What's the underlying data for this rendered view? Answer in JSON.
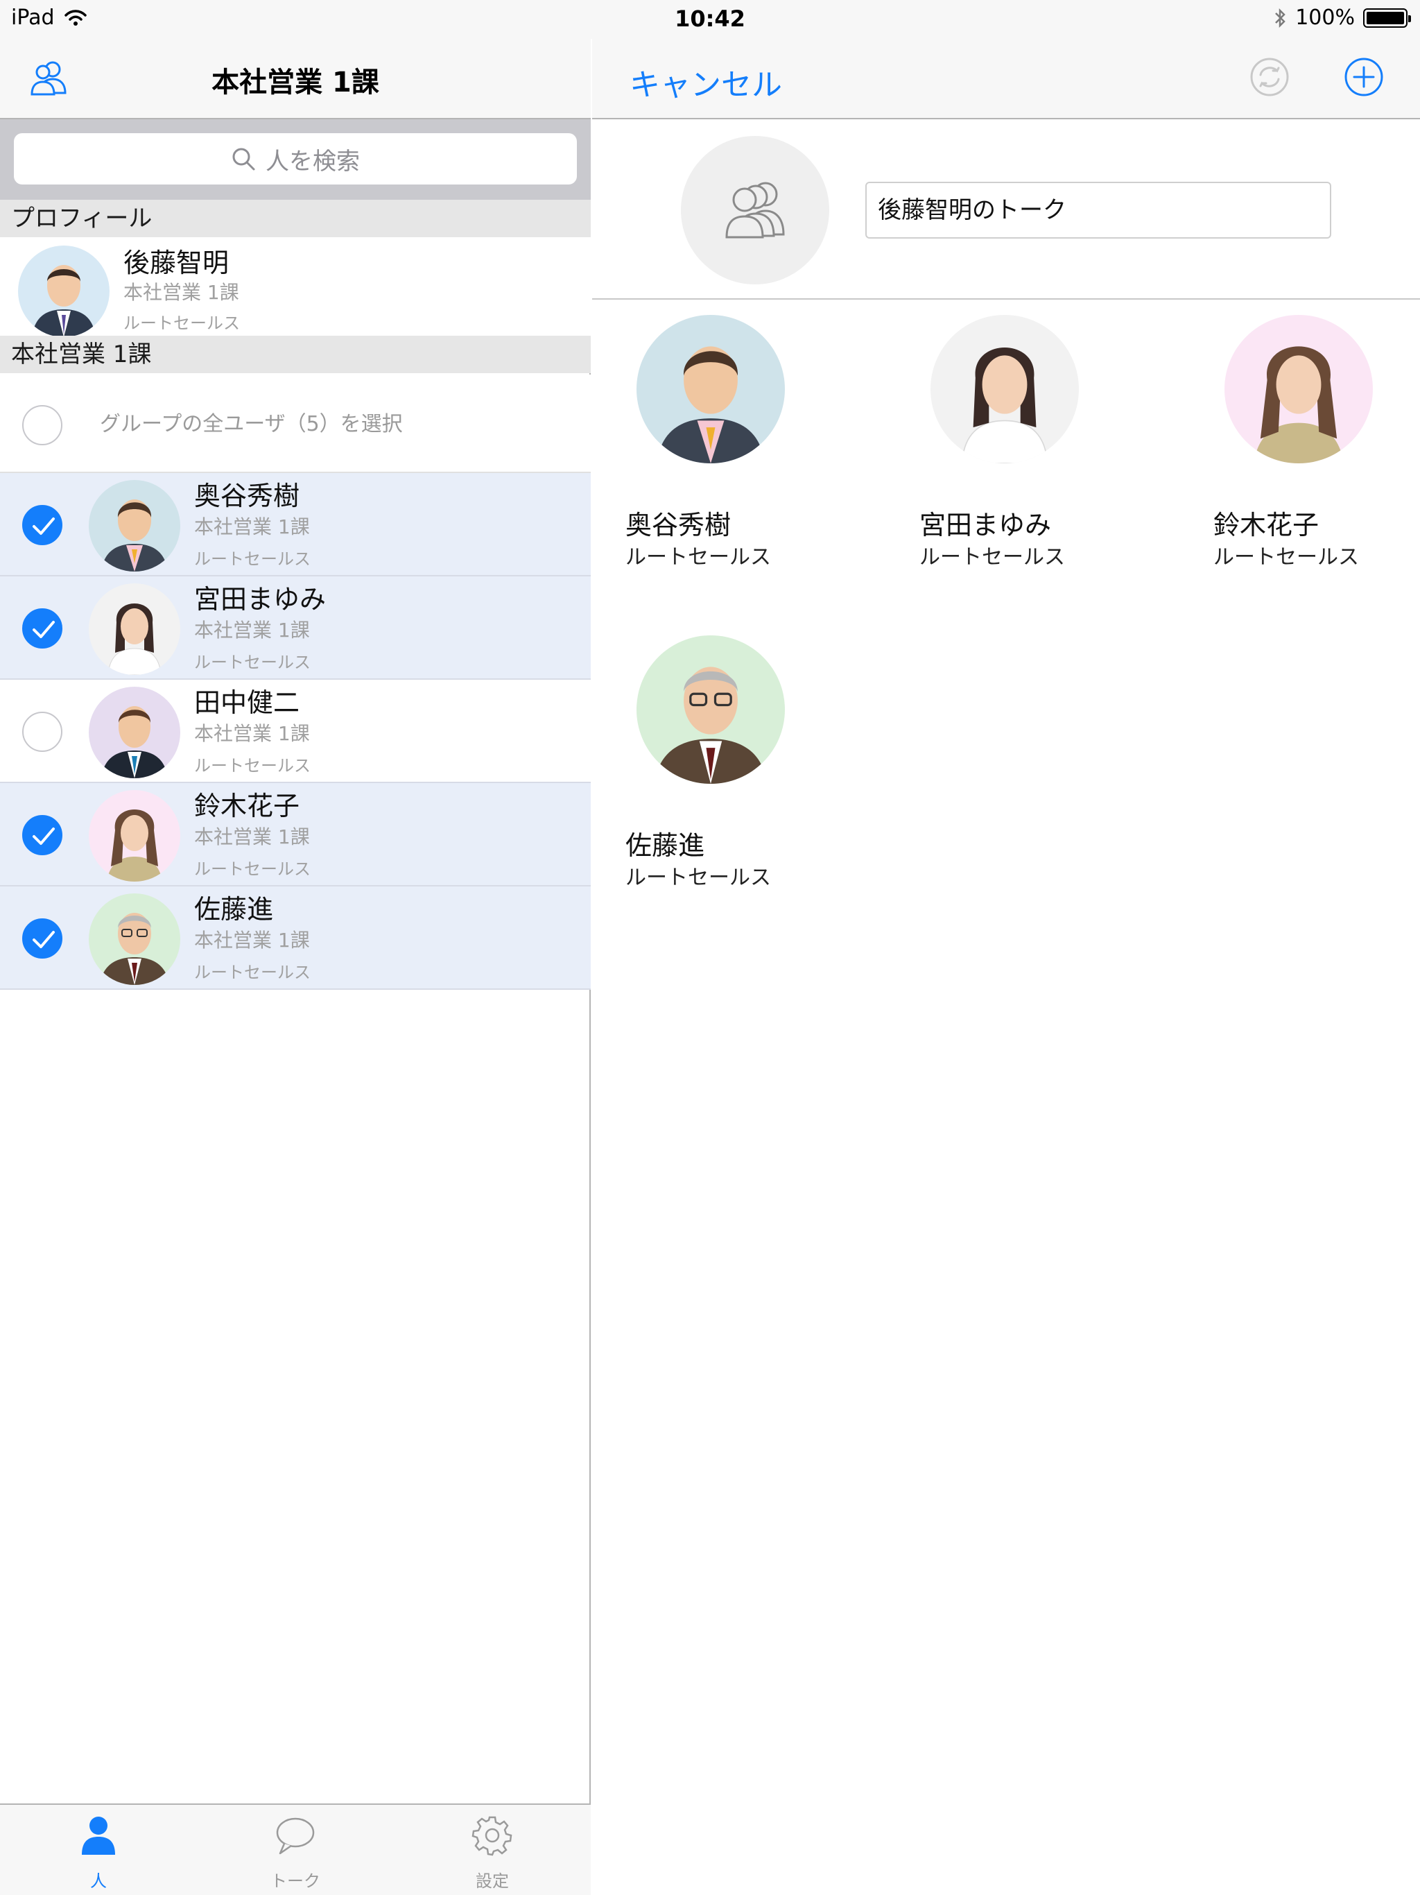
{
  "status_bar": {
    "device": "iPad",
    "time": "10:42",
    "battery": "100%"
  },
  "left_nav": {
    "title": "本社営業 1課"
  },
  "search": {
    "placeholder": "人を検索"
  },
  "sections": {
    "profile": "プロフィール",
    "group": "本社営業 1課"
  },
  "profile": {
    "name": "後藤智明",
    "department": "本社営業 1課",
    "role": "ルートセールス"
  },
  "select_all": {
    "label": "グループの全ユーザ（5）を選択",
    "checked": false
  },
  "members": [
    {
      "name": "奥谷秀樹",
      "department": "本社営業 1課",
      "role": "ルートセールス",
      "checked": true
    },
    {
      "name": "宮田まゆみ",
      "department": "本社営業 1課",
      "role": "ルートセールス",
      "checked": true
    },
    {
      "name": "田中健二",
      "department": "本社営業 1課",
      "role": "ルートセールス",
      "checked": false
    },
    {
      "name": "鈴木花子",
      "department": "本社営業 1課",
      "role": "ルートセールス",
      "checked": true
    },
    {
      "name": "佐藤進",
      "department": "本社営業 1課",
      "role": "ルートセールス",
      "checked": true
    }
  ],
  "tabs": [
    {
      "label": "人",
      "icon": "person-icon",
      "active": true
    },
    {
      "label": "トーク",
      "icon": "chat-bubble-icon",
      "active": false
    },
    {
      "label": "設定",
      "icon": "gear-icon",
      "active": false
    }
  ],
  "right_nav": {
    "cancel_label": "キャンセル",
    "sync_icon": "sync-icon",
    "add_icon": "add-circle-icon"
  },
  "talk": {
    "title_value": "後藤智明のトーク"
  },
  "selected_members": [
    {
      "name": "奥谷秀樹",
      "role": "ルートセールス"
    },
    {
      "name": "宮田まゆみ",
      "role": "ルートセールス"
    },
    {
      "name": "鈴木花子",
      "role": "ルートセールス"
    },
    {
      "name": "佐藤進",
      "role": "ルートセールス"
    }
  ],
  "colors": {
    "accent": "#147efb",
    "selected_row": "#e8eef9",
    "section_header": "#e6e6e6"
  }
}
